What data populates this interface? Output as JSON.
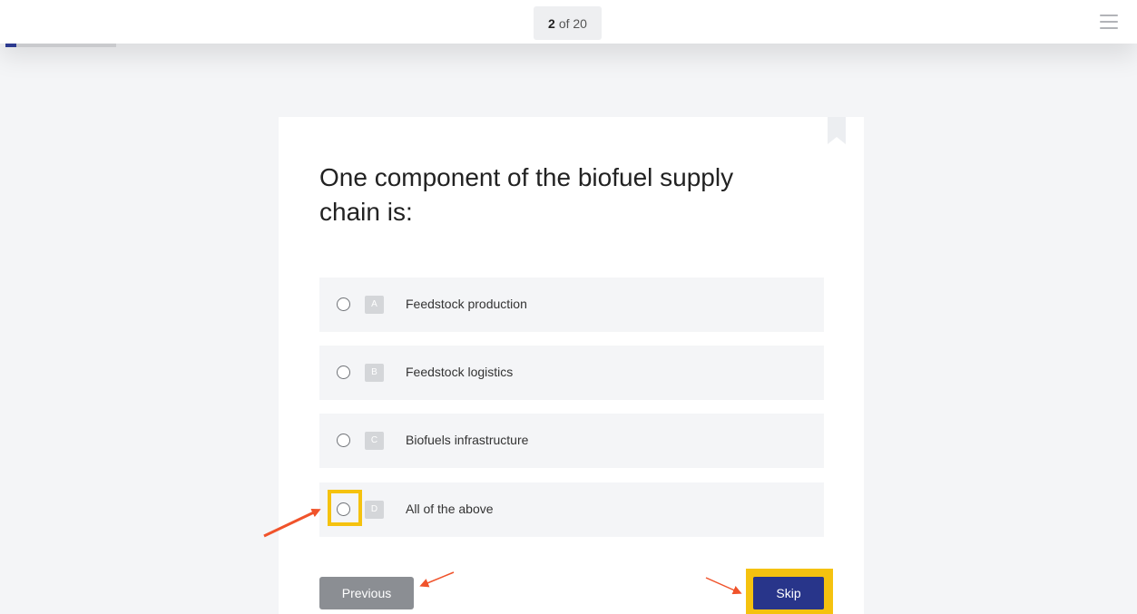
{
  "header": {
    "current_question": "2",
    "of_label": "of 20",
    "progress_fraction": 0.1
  },
  "question": {
    "text": "One component of the biofuel supply chain is:"
  },
  "options": [
    {
      "letter": "A",
      "label": "Feedstock production"
    },
    {
      "letter": "B",
      "label": "Feedstock logistics"
    },
    {
      "letter": "C",
      "label": "Biofuels infrastructure"
    },
    {
      "letter": "D",
      "label": "All of the above"
    }
  ],
  "buttons": {
    "previous_label": "Previous",
    "skip_label": "Skip"
  },
  "colors": {
    "accent": "#28358a",
    "highlight": "#f5c20f",
    "annotation_arrow": "#f0532b",
    "secondary_button": "#8b8e93"
  },
  "icons": {
    "menu": "hamburger-menu-icon",
    "bookmark": "bookmark-icon",
    "radio": "radio-unchecked-icon",
    "arrow": "annotation-arrow-icon"
  }
}
